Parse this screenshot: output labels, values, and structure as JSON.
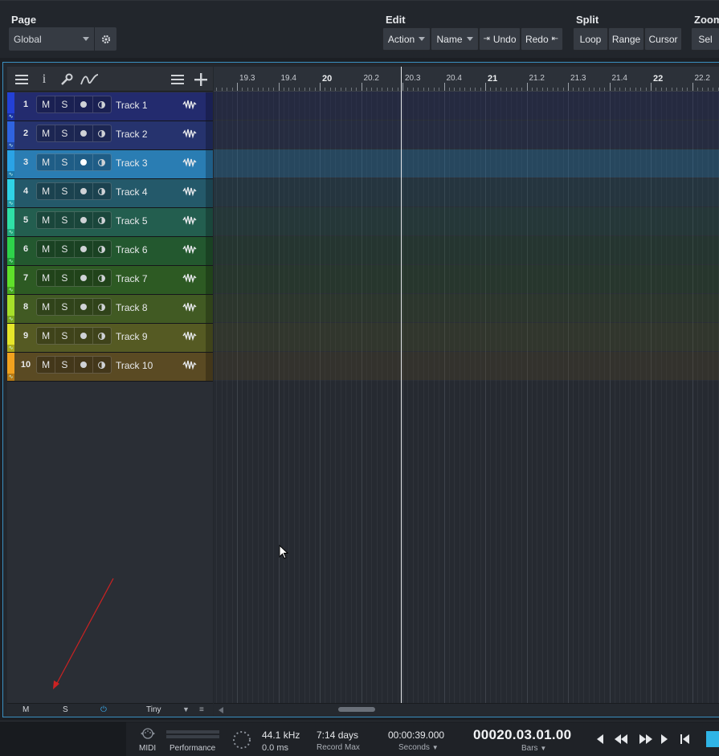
{
  "toolbar": {
    "page": {
      "title": "Page",
      "selected": "Global"
    },
    "edit": {
      "title": "Edit",
      "action": "Action",
      "name": "Name",
      "undo": "Undo",
      "redo": "Redo"
    },
    "split": {
      "title": "Split",
      "loop": "Loop",
      "range": "Range",
      "cursor": "Cursor"
    },
    "zoom": {
      "title": "Zoom",
      "sel": "Sel"
    }
  },
  "icons": {
    "list": "list-icon",
    "info": "info-icon",
    "wrench": "wrench-icon",
    "curve": "automation-curve-icon",
    "menu": "menu-icon",
    "add": "add-icon",
    "gear": "gear-icon",
    "waveform": "waveform-icon"
  },
  "tracks": [
    {
      "number": "1",
      "name": "Track 1",
      "color": "#2340d6",
      "bg": "#232b6e",
      "mute": "M",
      "solo": "S"
    },
    {
      "number": "2",
      "name": "Track 2",
      "color": "#2f63e0",
      "bg": "#26336e",
      "mute": "M",
      "solo": "S"
    },
    {
      "number": "3",
      "name": "Track 3",
      "color": "#2aa3e6",
      "bg": "#2a7db3",
      "mute": "M",
      "solo": "S",
      "selected": true
    },
    {
      "number": "4",
      "name": "Track 4",
      "color": "#2fd2e6",
      "bg": "#24596a",
      "mute": "M",
      "solo": "S"
    },
    {
      "number": "5",
      "name": "Track 5",
      "color": "#2fe0a6",
      "bg": "#235e4f",
      "mute": "M",
      "solo": "S"
    },
    {
      "number": "6",
      "name": "Track 6",
      "color": "#2ed24a",
      "bg": "#23582f",
      "mute": "M",
      "solo": "S"
    },
    {
      "number": "7",
      "name": "Track 7",
      "color": "#5fe02a",
      "bg": "#2d5a23",
      "mute": "M",
      "solo": "S"
    },
    {
      "number": "8",
      "name": "Track 8",
      "color": "#a6e02a",
      "bg": "#415a23",
      "mute": "M",
      "solo": "S"
    },
    {
      "number": "9",
      "name": "Track 9",
      "color": "#e6e62a",
      "bg": "#555a23",
      "mute": "M",
      "solo": "S"
    },
    {
      "number": "10",
      "name": "Track 10",
      "color": "#f2a21e",
      "bg": "#5a4a23",
      "mute": "M",
      "solo": "S"
    }
  ],
  "track_footer": {
    "m": "M",
    "s": "S",
    "size": "Tiny"
  },
  "ruler": [
    {
      "label": "19.3",
      "major": false
    },
    {
      "label": "19.4",
      "major": false
    },
    {
      "label": "20",
      "major": true
    },
    {
      "label": "20.2",
      "major": false
    },
    {
      "label": "20.3",
      "major": false
    },
    {
      "label": "20.4",
      "major": false
    },
    {
      "label": "21",
      "major": true
    },
    {
      "label": "21.2",
      "major": false
    },
    {
      "label": "21.3",
      "major": false
    },
    {
      "label": "21.4",
      "major": false
    },
    {
      "label": "22",
      "major": true
    },
    {
      "label": "22.2",
      "major": false
    }
  ],
  "transport": {
    "midi": "MIDI",
    "performance": "Performance",
    "sample_rate": "44.1 kHz",
    "latency": "0.0 ms",
    "record_days": "7:14 days",
    "record_max": "Record Max",
    "seconds_time": "00:00:39.000",
    "seconds_label": "Seconds",
    "bars_time": "00020.03.01.00",
    "bars_label": "Bars"
  }
}
